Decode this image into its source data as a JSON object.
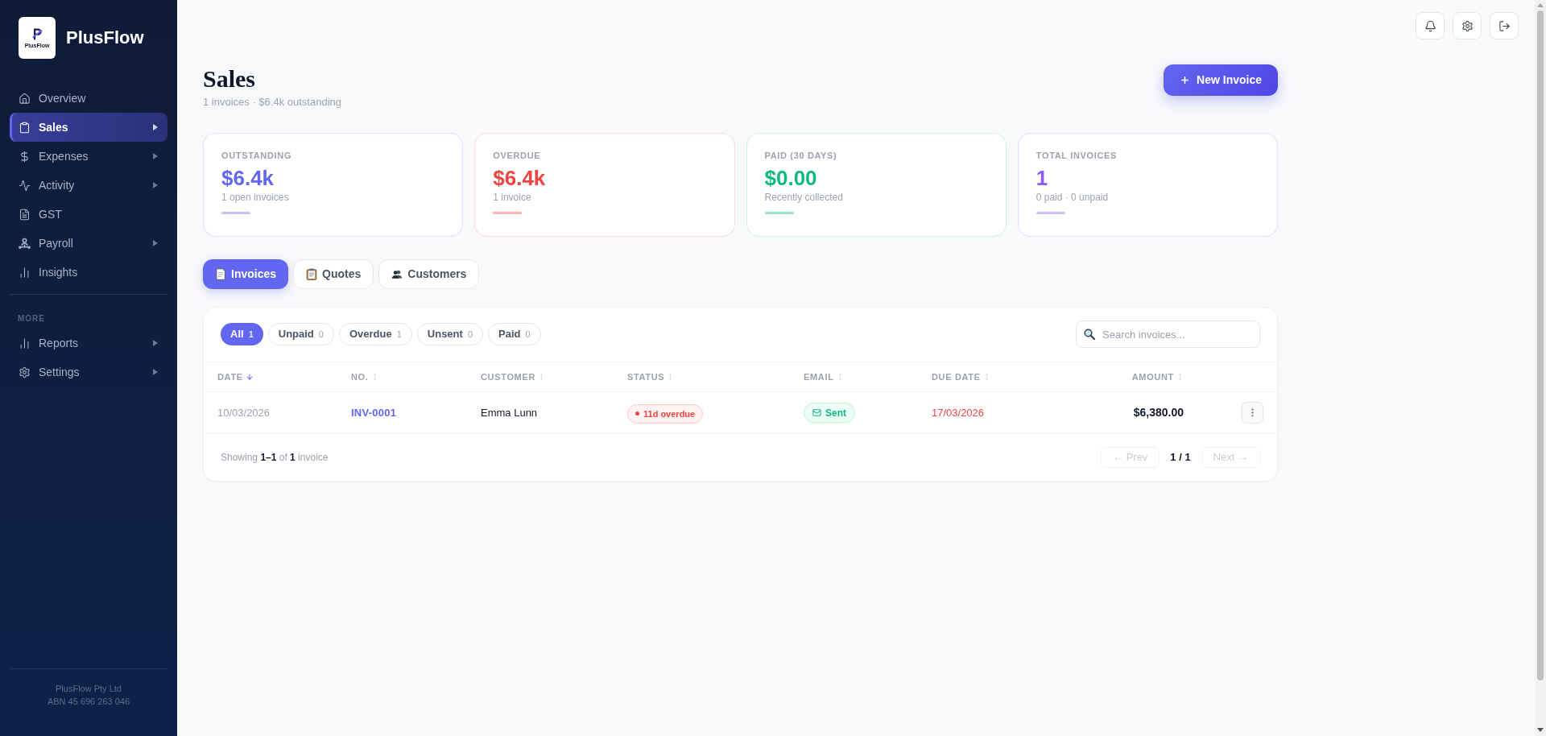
{
  "sidebar": {
    "logo_text": "PlusFlow",
    "brand": "PlusFlow",
    "nav": [
      {
        "label": "Overview",
        "selected": false,
        "has_submenu": false
      },
      {
        "label": "Sales",
        "selected": true,
        "has_submenu": true
      },
      {
        "label": "Expenses",
        "selected": false,
        "has_submenu": true
      },
      {
        "label": "Activity",
        "selected": false,
        "has_submenu": true
      },
      {
        "label": "GST",
        "selected": false,
        "has_submenu": false
      },
      {
        "label": "Payroll",
        "selected": false,
        "has_submenu": true
      },
      {
        "label": "Insights",
        "selected": false,
        "has_submenu": false
      }
    ],
    "section_label": "MORE",
    "more_nav": [
      {
        "label": "Reports",
        "selected": false,
        "has_submenu": true
      },
      {
        "label": "Settings",
        "selected": false,
        "has_submenu": true
      }
    ],
    "footer": [
      "PlusFlow Pty Ltd",
      "ABN 45 696 263 046"
    ]
  },
  "header": {
    "title": "Sales",
    "subtitle": "1 invoices · $6.4k outstanding",
    "new_button": "New Invoice"
  },
  "stats": [
    {
      "label": "OUTSTANDING",
      "value": "$6.4k",
      "note": "1 open invoices",
      "color": "#6366f1"
    },
    {
      "label": "OVERDUE",
      "value": "$6.4k",
      "note": "1 invoice",
      "color": "#ef4444"
    },
    {
      "label": "PAID (30 DAYS)",
      "value": "$0.00",
      "note": "Recently collected",
      "color": "#10b981"
    },
    {
      "label": "TOTAL INVOICES",
      "value": "1",
      "note": "0 paid · 0 unpaid",
      "color": "#8b5cf6"
    }
  ],
  "tabs": [
    {
      "label": "Invoices",
      "selected": true
    },
    {
      "label": "Quotes",
      "selected": false
    },
    {
      "label": "Customers",
      "selected": false
    }
  ],
  "invoices": {
    "filters": [
      {
        "label": "All",
        "count": "1",
        "selected": true
      },
      {
        "label": "Unpaid",
        "count": "0",
        "selected": false
      },
      {
        "label": "Overdue",
        "count": "1",
        "selected": false
      },
      {
        "label": "Unsent",
        "count": "0",
        "selected": false
      },
      {
        "label": "Paid",
        "count": "0",
        "selected": false
      }
    ],
    "search": {
      "placeholder": "Search invoices..."
    },
    "table": {
      "columns": [
        {
          "label": "DATE",
          "sorted": true
        },
        {
          "label": "NO.",
          "sorted": false
        },
        {
          "label": "CUSTOMER",
          "sorted": false
        },
        {
          "label": "STATUS",
          "sorted": false
        },
        {
          "label": "EMAIL",
          "sorted": false
        },
        {
          "label": "DUE DATE",
          "sorted": false
        },
        {
          "label": "AMOUNT",
          "sorted": false
        }
      ],
      "rows": [
        {
          "date": "10/03/2026",
          "number": "INV-0001",
          "customer": "Emma Lunn",
          "status": {
            "kind": "overdue",
            "label": "11d overdue"
          },
          "email": {
            "kind": "sent",
            "label": "Sent"
          },
          "due_date": "17/03/2026",
          "due_overdue": true,
          "amount": "$6,380.00"
        }
      ]
    },
    "footer": {
      "summary": "Showing **1–1** of **1** invoice",
      "prev": {
        "label": "← Prev",
        "disabled": true
      },
      "page": "1 / 1",
      "next": {
        "label": "Next →",
        "disabled": true
      }
    }
  }
}
